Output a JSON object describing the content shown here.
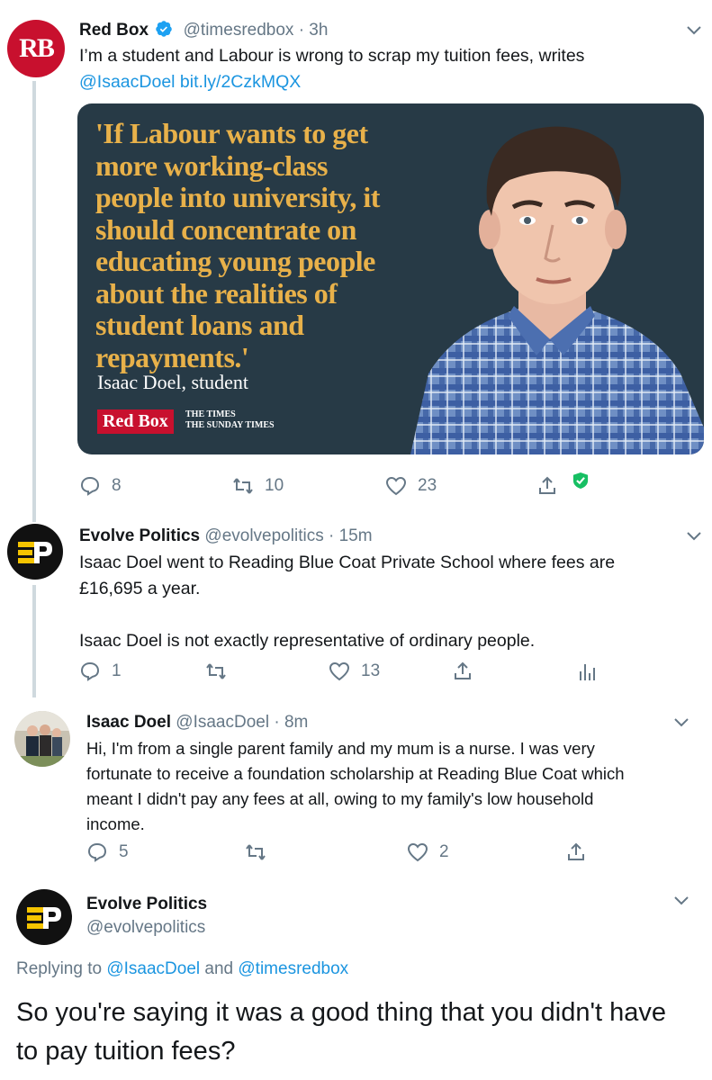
{
  "tweets": [
    {
      "name": "Red Box",
      "handle": "@timesredbox",
      "time": "· 3h",
      "avatar_text": "RB",
      "text": "I’m a student and Labour is wrong to scrap my tuition fees, writes",
      "links": "@IsaacDoel bit.ly/2CzkMQX",
      "replies": "8",
      "retweets": "10",
      "likes": "23"
    },
    {
      "name": "Evolve Politics",
      "handle": "@evolvepolitics",
      "time": "· 15m",
      "text_1": "Isaac Doel went to Reading Blue Coat Private School where fees are",
      "text_2": "£16,695 a year.",
      "text_3": "Isaac Doel is not exactly representative of ordinary people.",
      "replies": "1",
      "retweets": "",
      "likes": "13"
    },
    {
      "name": "Isaac Doel",
      "handle": "@IsaacDoel",
      "time": "· 8m",
      "text_1": "Hi, I'm from a single parent family and my mum is a nurse. I was very",
      "text_2": "fortunate to receive a foundation scholarship at Reading Blue Coat which",
      "text_3": "meant I didn't pay any fees at all, owing to my family's low household",
      "text_4": "income.",
      "replies": "5",
      "retweets": "",
      "likes": "2"
    },
    {
      "name": "Evolve Politics",
      "handle": "@evolvepolitics",
      "replying_prefix": "Replying to",
      "replying_user1": "@IsaacDoel",
      "replying_and": "and",
      "replying_user2": "@timesredbox",
      "text_1": "So you're saying it was a good thing that you didn't have",
      "text_2": "to pay tuition fees?"
    }
  ],
  "card": {
    "quote": "'If Labour wants to get more working-class people into university, it should concentrate on educating young people about the realities of student loans and repayments.'",
    "author": "Isaac Doel, student",
    "logo": "Red Box",
    "times_line1": "THE TIMES",
    "times_line2": "THE SUNDAY TIMES"
  },
  "colors": {
    "link": "#1b95e0",
    "card_bg": "#273a46",
    "quote_gold": "#e8b14a",
    "redbox_red": "#c8102e",
    "evolve_yellow": "#f5c400"
  }
}
